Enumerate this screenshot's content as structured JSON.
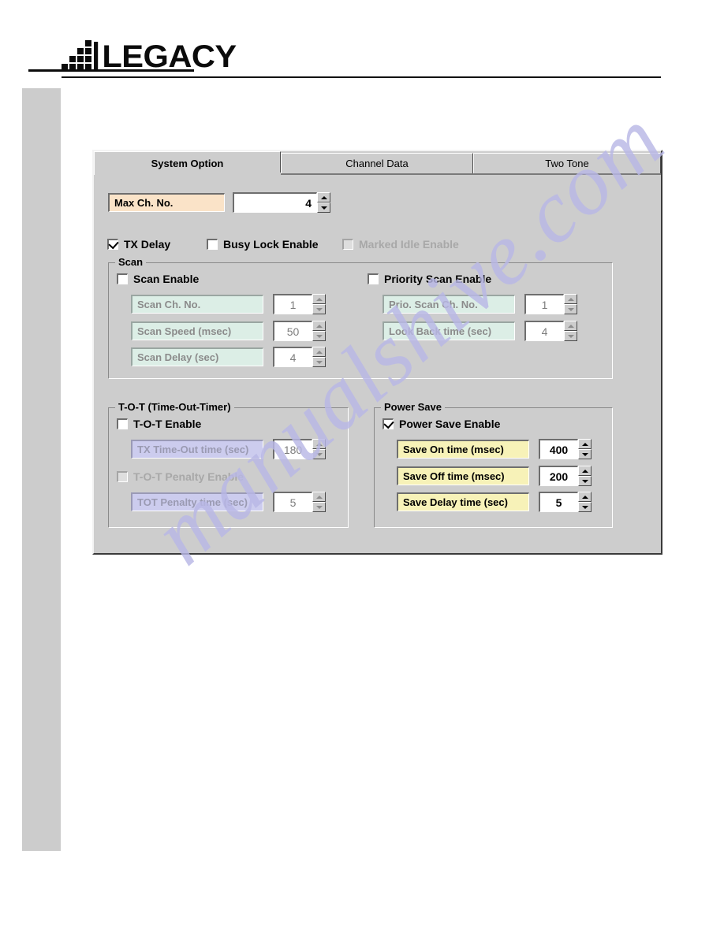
{
  "header": {
    "logo_text": "LEGACY"
  },
  "watermark": {
    "text": "manualshive.com"
  },
  "dialog": {
    "tabs": [
      {
        "label": "System Option",
        "active": true
      },
      {
        "label": "Channel Data",
        "active": false
      },
      {
        "label": "Two Tone",
        "active": false
      }
    ],
    "max_ch": {
      "label": "Max Ch. No.",
      "value": "4"
    },
    "toggles": [
      {
        "label": "TX Delay",
        "checked": true,
        "disabled": false
      },
      {
        "label": "Busy Lock Enable",
        "checked": false,
        "disabled": false
      },
      {
        "label": "Marked Idle Enable",
        "checked": false,
        "disabled": true
      }
    ],
    "scan": {
      "title": "Scan",
      "enable": {
        "label": "Scan Enable",
        "checked": false
      },
      "priority_enable": {
        "label": "Priority Scan Enable",
        "checked": false
      },
      "left_fields": [
        {
          "label": "Scan Ch. No.",
          "value": "1"
        },
        {
          "label": "Scan Speed  (msec)",
          "value": "50"
        },
        {
          "label": "Scan Delay  (sec)",
          "value": "4"
        }
      ],
      "right_fields": [
        {
          "label": "Prio. Scan Ch. No.",
          "value": "1"
        },
        {
          "label": "Look Back time  (sec)",
          "value": "4"
        }
      ]
    },
    "tot": {
      "title": "T-O-T (Time-Out-Timer)",
      "enable": {
        "label": "T-O-T Enable",
        "checked": false,
        "disabled": false
      },
      "penalty_enable": {
        "label": "T-O-T Penalty Enable",
        "checked": false,
        "disabled": true
      },
      "fields": [
        {
          "label": "TX Time-Out time (sec)",
          "value": "180"
        },
        {
          "label": "TOT Penalty time (sec)",
          "value": "5"
        }
      ]
    },
    "power_save": {
      "title": "Power Save",
      "enable": {
        "label": "Power Save Enable",
        "checked": true
      },
      "fields": [
        {
          "label": "Save On time (msec)",
          "value": "400"
        },
        {
          "label": "Save Off time (msec)",
          "value": "200"
        },
        {
          "label": "Save Delay time (sec)",
          "value": "5"
        }
      ]
    }
  },
  "colors": {
    "dialog_face": "#cdcdcd",
    "peach_label": "#fae3c8",
    "mint_label": "#dceee6",
    "lavender_label": "#ccccee",
    "yellow_label": "#f7f2b8",
    "watermark": "#b9b8e6"
  }
}
